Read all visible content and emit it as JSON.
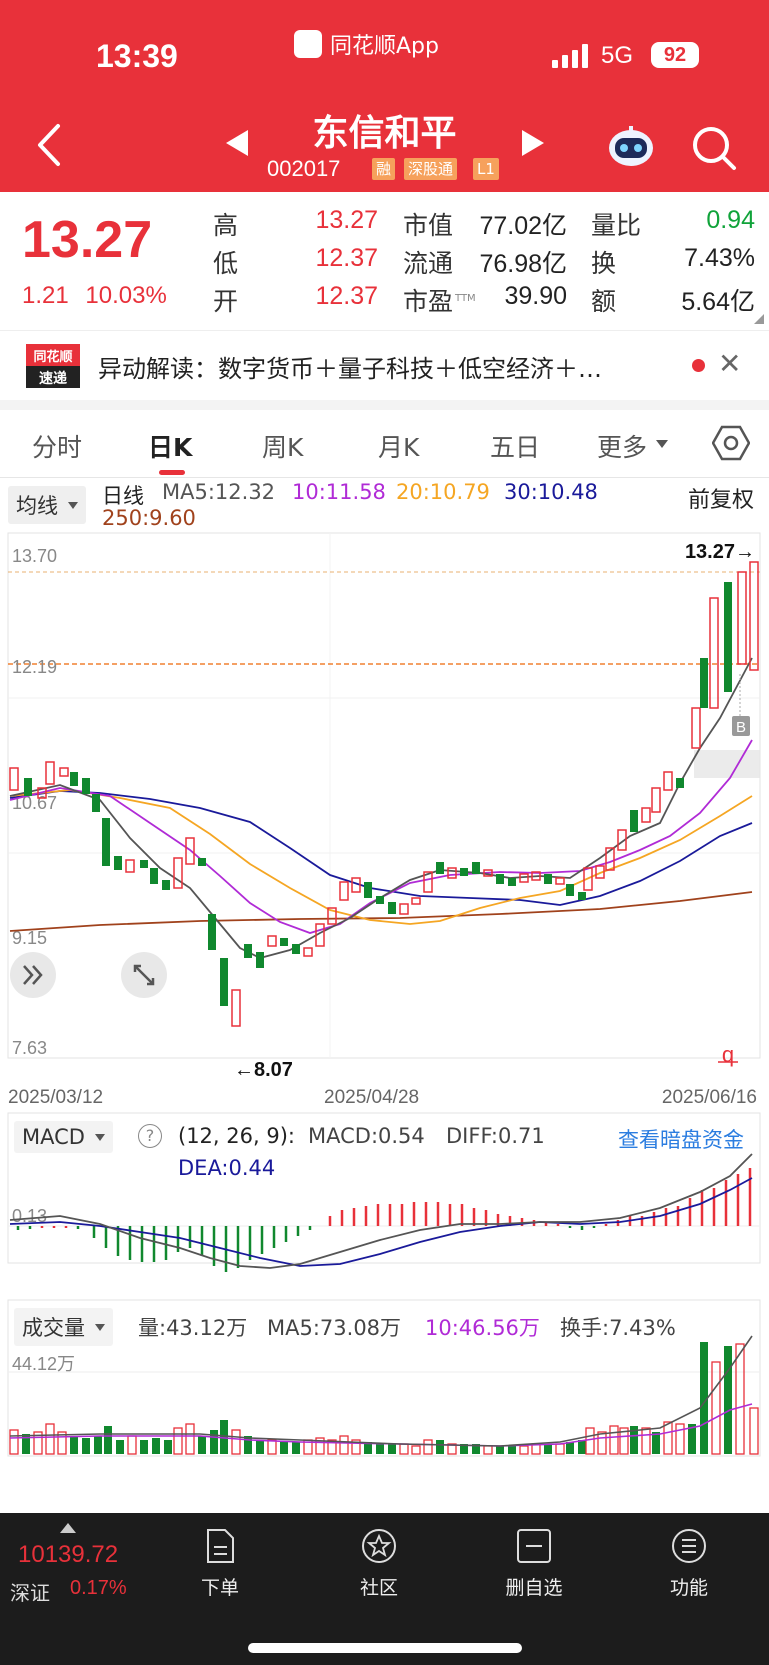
{
  "status_bar": {
    "time": "13:39",
    "app_label": "同花顺App",
    "network": "5G",
    "battery": "92"
  },
  "header": {
    "stock_name": "东信和平",
    "stock_code": "002017",
    "tags": [
      "融",
      "深股通",
      "L1"
    ]
  },
  "quote": {
    "price": "13.27",
    "change": "1.21",
    "change_pct": "10.03%",
    "stats": [
      {
        "label": "高",
        "value": "13.27"
      },
      {
        "label": "低",
        "value": "12.37"
      },
      {
        "label": "开",
        "value": "12.37"
      },
      {
        "label": "市值",
        "value": "77.02亿"
      },
      {
        "label": "流通",
        "value": "76.98亿"
      },
      {
        "label": "市盈",
        "sup": "TTM",
        "value": "39.90"
      },
      {
        "label": "量比",
        "value": "0.94"
      },
      {
        "label": "换",
        "value": "7.43%"
      },
      {
        "label": "额",
        "value": "5.64亿"
      }
    ]
  },
  "news": {
    "logo_top": "同花顺",
    "logo_bottom": "速递",
    "text": "异动解读：数字货币＋量子科技＋低空经济＋…"
  },
  "tabs": [
    "分时",
    "日K",
    "周K",
    "月K",
    "五日",
    "更多"
  ],
  "kline": {
    "indicator_dropdown": "均线",
    "period": "日线",
    "ma": [
      {
        "label": "MA5:12.32",
        "color": "#555555"
      },
      {
        "label": "10:11.58",
        "color": "#b02bd6"
      },
      {
        "label": "20:10.79",
        "color": "#f5a623"
      },
      {
        "label": "30:10.48",
        "color": "#1a1a9a"
      },
      {
        "label": "250:9.60",
        "color": "#a0421c"
      }
    ],
    "adjust": "前复权",
    "y_labels": [
      "13.70",
      "12.19",
      "10.67",
      "9.15",
      "7.63"
    ],
    "high_label": "13.27→",
    "low_label": "←8.07",
    "dates": [
      "2025/03/12",
      "2025/04/28",
      "2025/06/16"
    ],
    "buy_marker": "B",
    "corner_mark": "q"
  },
  "macd": {
    "dropdown": "MACD",
    "help": "?",
    "params": "(12, 26, 9):",
    "macd": "MACD:0.54",
    "diff": "DIFF:0.71",
    "dea": "DEA:0.44",
    "link": "查看暗盘资金",
    "y_label": "0.13"
  },
  "volume": {
    "dropdown": "成交量",
    "vol": "量:43.12万",
    "ma5": "MA5:73.08万",
    "ma10": "10:46.56万",
    "turnover": "换手:7.43%",
    "y_label": "44.12万"
  },
  "bottom": {
    "index_value": "10139.72",
    "index_name": "深证",
    "index_pct": "0.17%",
    "items": [
      "下单",
      "社区",
      "删自选",
      "功能"
    ]
  },
  "colors": {
    "up": "#e8313a",
    "down": "#10882e",
    "header_bg": "#e8313a",
    "link": "#2b7de0"
  }
}
